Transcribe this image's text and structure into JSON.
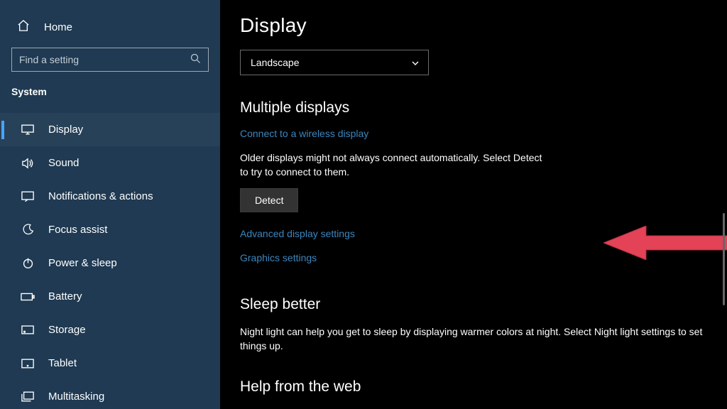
{
  "sidebar": {
    "home": "Home",
    "search_placeholder": "Find a setting",
    "section": "System",
    "items": [
      {
        "label": "Display"
      },
      {
        "label": "Sound"
      },
      {
        "label": "Notifications & actions"
      },
      {
        "label": "Focus assist"
      },
      {
        "label": "Power & sleep"
      },
      {
        "label": "Battery"
      },
      {
        "label": "Storage"
      },
      {
        "label": "Tablet"
      },
      {
        "label": "Multitasking"
      }
    ]
  },
  "main": {
    "title": "Display",
    "orientation_value": "Landscape",
    "multiple_displays_heading": "Multiple displays",
    "connect_wireless_link": "Connect to a wireless display",
    "detect_help": "Older displays might not always connect automatically. Select Detect to try to connect to them.",
    "detect_button": "Detect",
    "advanced_link": "Advanced display settings",
    "graphics_link": "Graphics settings",
    "sleep_heading": "Sleep better",
    "sleep_body": "Night light can help you get to sleep by displaying warmer colors at night. Select Night light settings to set things up.",
    "help_heading": "Help from the web"
  },
  "colors": {
    "sidebar_bg": "#1f3a52",
    "accent": "#4aa3ff",
    "link": "#3d86bd",
    "arrow": "#e44256"
  }
}
